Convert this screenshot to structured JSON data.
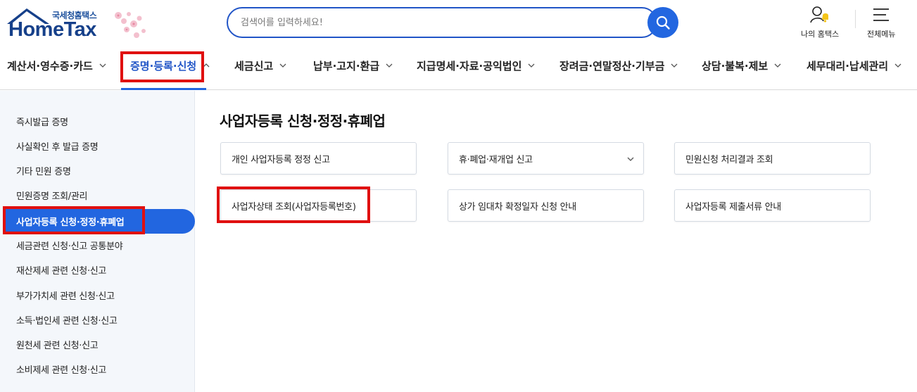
{
  "header": {
    "logo_sub": "국세청홈택스",
    "logo_main": "HomeTax",
    "search_placeholder": "검색어를 입력하세요!",
    "my_hometax_label": "나의 홈택스",
    "all_menu_label": "전체메뉴"
  },
  "gnb": {
    "items": [
      {
        "label": "계산서·영수증·카드",
        "icon": "chevron-down-icon"
      },
      {
        "label": "증명·등록·신청",
        "icon": "chevron-up-icon",
        "active": true
      },
      {
        "label": "세금신고",
        "icon": "chevron-down-icon"
      },
      {
        "label": "납부·고지·환급",
        "icon": "chevron-down-icon"
      },
      {
        "label": "지급명세·자료·공익법인",
        "icon": "chevron-down-icon"
      },
      {
        "label": "장려금·연말정산·기부금",
        "icon": "chevron-down-icon"
      },
      {
        "label": "상담·불복·제보",
        "icon": "chevron-down-icon"
      },
      {
        "label": "세무대리·납세관리",
        "icon": "chevron-down-icon"
      }
    ]
  },
  "sidebar": {
    "items": [
      {
        "label": "즉시발급 증명"
      },
      {
        "label": "사실확인 후 발급 증명"
      },
      {
        "label": "기타 민원 증명"
      },
      {
        "label": "민원증명 조회/관리"
      },
      {
        "label": "사업자등록 신청·정정·휴폐업",
        "active": true
      },
      {
        "label": "세금관련 신청·신고 공통분야"
      },
      {
        "label": "재산제세 관련 신청·신고"
      },
      {
        "label": "부가가치세 관련 신청·신고"
      },
      {
        "label": "소득·법인세 관련 신청·신고"
      },
      {
        "label": "원천세 관련 신청·신고"
      },
      {
        "label": "소비제세 관련 신청·신고"
      }
    ]
  },
  "main": {
    "title": "사업자등록 신청·정정·휴폐업",
    "cards": [
      {
        "label": "개인 사업자등록 정정 신고"
      },
      {
        "label": "휴·폐업·재개업 신고",
        "icon": "chevron-down-icon"
      },
      {
        "label": "민원신청 처리결과 조회"
      },
      {
        "label": "사업자상태 조회(사업자등록번호)"
      },
      {
        "label": "상가 임대차 확정일자 신청 안내"
      },
      {
        "label": "사업자등록 제출서류 안내"
      }
    ]
  },
  "colors": {
    "brand_blue": "#2266e0",
    "logo_navy": "#16408a",
    "highlight_red": "#e01010",
    "sidebar_bg": "#f4f7fb"
  }
}
